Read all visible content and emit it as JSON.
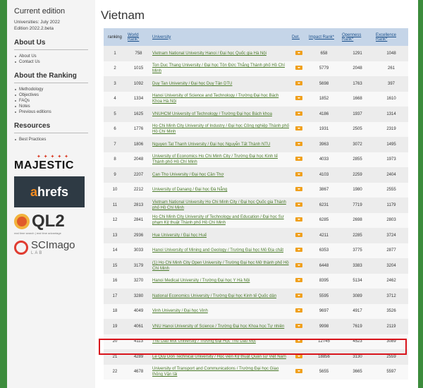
{
  "sidebar": {
    "current_edition_title": "Current edition",
    "edition_line1": "Universities: July 2022",
    "edition_line2": "Edition 2022.2.beta",
    "about_us_heading": "About Us",
    "about_us_items": [
      "About Us",
      "Contact Us"
    ],
    "about_ranking_heading": "About the Ranking",
    "about_ranking_items": [
      "Methodology",
      "Objectives",
      "FAQs",
      "Notes",
      "Previous editions"
    ],
    "resources_heading": "Resources",
    "resources_items": [
      "Best Practices"
    ],
    "logos": {
      "majestic": "MAJESTIC",
      "ahrefs_a": "a",
      "ahrefs_rest": "hrefs",
      "ql2": "QL2",
      "ql2_tagline": "real time search | real time advantage",
      "scimago": "SCImago",
      "scimago_lab": "LAB"
    }
  },
  "main": {
    "title": "Vietnam",
    "headers": {
      "ranking": "ranking",
      "world_rank": "World Rank*",
      "university": "University",
      "det": "Det.",
      "impact": "Impact Rank*",
      "openness": "Openness Rank*",
      "excellence": "Excellence Rank*"
    },
    "rows": [
      {
        "ranking": "1",
        "world": "758",
        "university": "Vietnam National University Hanoi / Đại học Quốc gia Hà Nội",
        "impact": "658",
        "openness": "1291",
        "excellence": "1048"
      },
      {
        "ranking": "2",
        "world": "1015",
        "university": "Ton Duc Thang University / Đại học Tôn Đức Thắng Thành phố Hồ Chí Minh",
        "impact": "5779",
        "openness": "2048",
        "excellence": "261"
      },
      {
        "ranking": "3",
        "world": "1092",
        "university": "Duy Tan University / Đại học Duy Tân DTU",
        "impact": "5698",
        "openness": "1763",
        "excellence": "397"
      },
      {
        "ranking": "4",
        "world": "1334",
        "university": "Hanoi University of Science and Technology / Trường Đại học Bách Khoa Hà Nội",
        "impact": "1852",
        "openness": "1668",
        "excellence": "1610"
      },
      {
        "ranking": "5",
        "world": "1625",
        "university": "VNUHCM University of Technology / Trường Đại học Bách khoa",
        "impact": "4186",
        "openness": "1937",
        "excellence": "1314"
      },
      {
        "ranking": "6",
        "world": "1776",
        "university": "Ho Chi Minh City University of Industry / Đại học Công nghiệp Thành phố Hồ Chí Minh",
        "impact": "1931",
        "openness": "2505",
        "excellence": "2319"
      },
      {
        "ranking": "7",
        "world": "1806",
        "university": "Nguyen Tat Thanh University / Đại học Nguyễn Tất Thành NTU",
        "impact": "3963",
        "openness": "3072",
        "excellence": "1495"
      },
      {
        "ranking": "8",
        "world": "2048",
        "university": "University of Economics Ho Chi Minh City / Trường Đại học Kinh tế Thành phố Hồ Chí Minh",
        "impact": "4033",
        "openness": "2855",
        "excellence": "1973"
      },
      {
        "ranking": "9",
        "world": "2207",
        "university": "Can Tho University / Đại học Cần Thơ",
        "impact": "4103",
        "openness": "2259",
        "excellence": "2404"
      },
      {
        "ranking": "10",
        "world": "2212",
        "university": "University of Danang / Đại học Đà Nẵng",
        "impact": "3867",
        "openness": "1980",
        "excellence": "2555"
      },
      {
        "ranking": "11",
        "world": "2813",
        "university": "Vietnam National University Ho Chi Minh City / Đại học Quốc gia Thành phố Hồ Chí Minh",
        "impact": "6231",
        "openness": "7719",
        "excellence": "1179"
      },
      {
        "ranking": "12",
        "world": "2841",
        "university": "Ho Chi Minh City University of Technology and Education / Đại học Sư phạm Kỹ thuật Thành phố Hồ Chí Minh",
        "impact": "6285",
        "openness": "2698",
        "excellence": "2803"
      },
      {
        "ranking": "13",
        "world": "2936",
        "university": "Hue University / Đại học Huế",
        "impact": "4211",
        "openness": "2285",
        "excellence": "3724"
      },
      {
        "ranking": "14",
        "world": "3033",
        "university": "Hanoi University of Mining and Geology / Trường Đại học Mỏ Địa chất",
        "impact": "6353",
        "openness": "3775",
        "excellence": "2877"
      },
      {
        "ranking": "15",
        "world": "3179",
        "university": "(1) Ho Chi Minh City Open University / Trường Đại học Mở thành phố Hồ Chí Minh",
        "impact": "6448",
        "openness": "3383",
        "excellence": "3204"
      },
      {
        "ranking": "16",
        "world": "3270",
        "university": "Hanoi Medical University / Trường Đại học Y Hà Nội",
        "impact": "8395",
        "openness": "5134",
        "excellence": "2462"
      },
      {
        "ranking": "17",
        "world": "3280",
        "university": "National Economics University / Trường Đại học Kinh tế Quốc dân",
        "impact": "5595",
        "openness": "3089",
        "excellence": "3712"
      },
      {
        "ranking": "18",
        "world": "4049",
        "university": "Vinh University / Đại học Vinh",
        "impact": "9697",
        "openness": "4917",
        "excellence": "3526"
      },
      {
        "ranking": "19",
        "world": "4061",
        "university": "VNU Hanoi University of Science / Trường Đại học Khoa học Tự nhiên",
        "impact": "9998",
        "openness": "7619",
        "excellence": "2119"
      },
      {
        "ranking": "20",
        "world": "4113",
        "university": "Thu Dau Mot University / Trường Đại Học Thủ Dầu Một",
        "impact": "12745",
        "openness": "4523",
        "excellence": "3089"
      },
      {
        "ranking": "21",
        "world": "4289",
        "university": "Le Quy Don Technical University / Học viện Kỹ thuật Quân sự Việt Nam",
        "impact": "18856",
        "openness": "3130",
        "excellence": "2559"
      },
      {
        "ranking": "22",
        "world": "4678",
        "university": "University of Transport and Communications / Trường Đại học Giao thông Vận tải",
        "impact": "5655",
        "openness": "3665",
        "excellence": "5597"
      }
    ]
  },
  "highlighted_row": "20",
  "colors": {
    "highlight": "#d8141c",
    "header_bg": "#c5d5e8",
    "link": "#4a7a2a",
    "det_button": "#f0a01e"
  }
}
